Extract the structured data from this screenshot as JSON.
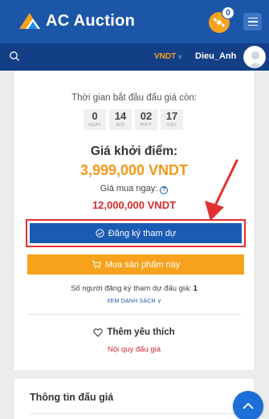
{
  "header": {
    "app_title": "AC Auction",
    "notification_count": "0",
    "logo_icon": "ac-logo-icon",
    "menu_icon": "hamburger-menu-icon",
    "brand_color": "#1c56a9"
  },
  "subheader": {
    "currency": "VNDT",
    "username": "Dieu_Anh"
  },
  "countdown": {
    "title": "Thời gian bắt đầu đấu giá còn:",
    "units": [
      {
        "value": "0",
        "label": "NGÀY"
      },
      {
        "value": "14",
        "label": "GIỜ"
      },
      {
        "value": "02",
        "label": "PHÚT"
      },
      {
        "value": "17",
        "label": "GIÂY"
      }
    ]
  },
  "pricing": {
    "start_label": "Giá khởi điểm:",
    "start_price": "3,999,000 VNDT",
    "buy_now_label": "Giá mua ngay:",
    "buy_now_price": "12,000,000 VNDT"
  },
  "actions": {
    "register_label": "Đăng ký tham dự",
    "buy_label": "Mua sản phẩm này",
    "registered_text": "Số người đăng ký tham dự đấu giá:",
    "registered_count": "1",
    "view_list": "XEM DANH SÁCH",
    "favorite_label": "Thêm yêu thích",
    "rules_link": "Nội quy đấu giá"
  },
  "info": {
    "title": "Thông tin đấu giá"
  },
  "colors": {
    "accent_orange": "#f7a21d",
    "price_red": "#d62b2b",
    "highlight_red": "#e2312f"
  }
}
